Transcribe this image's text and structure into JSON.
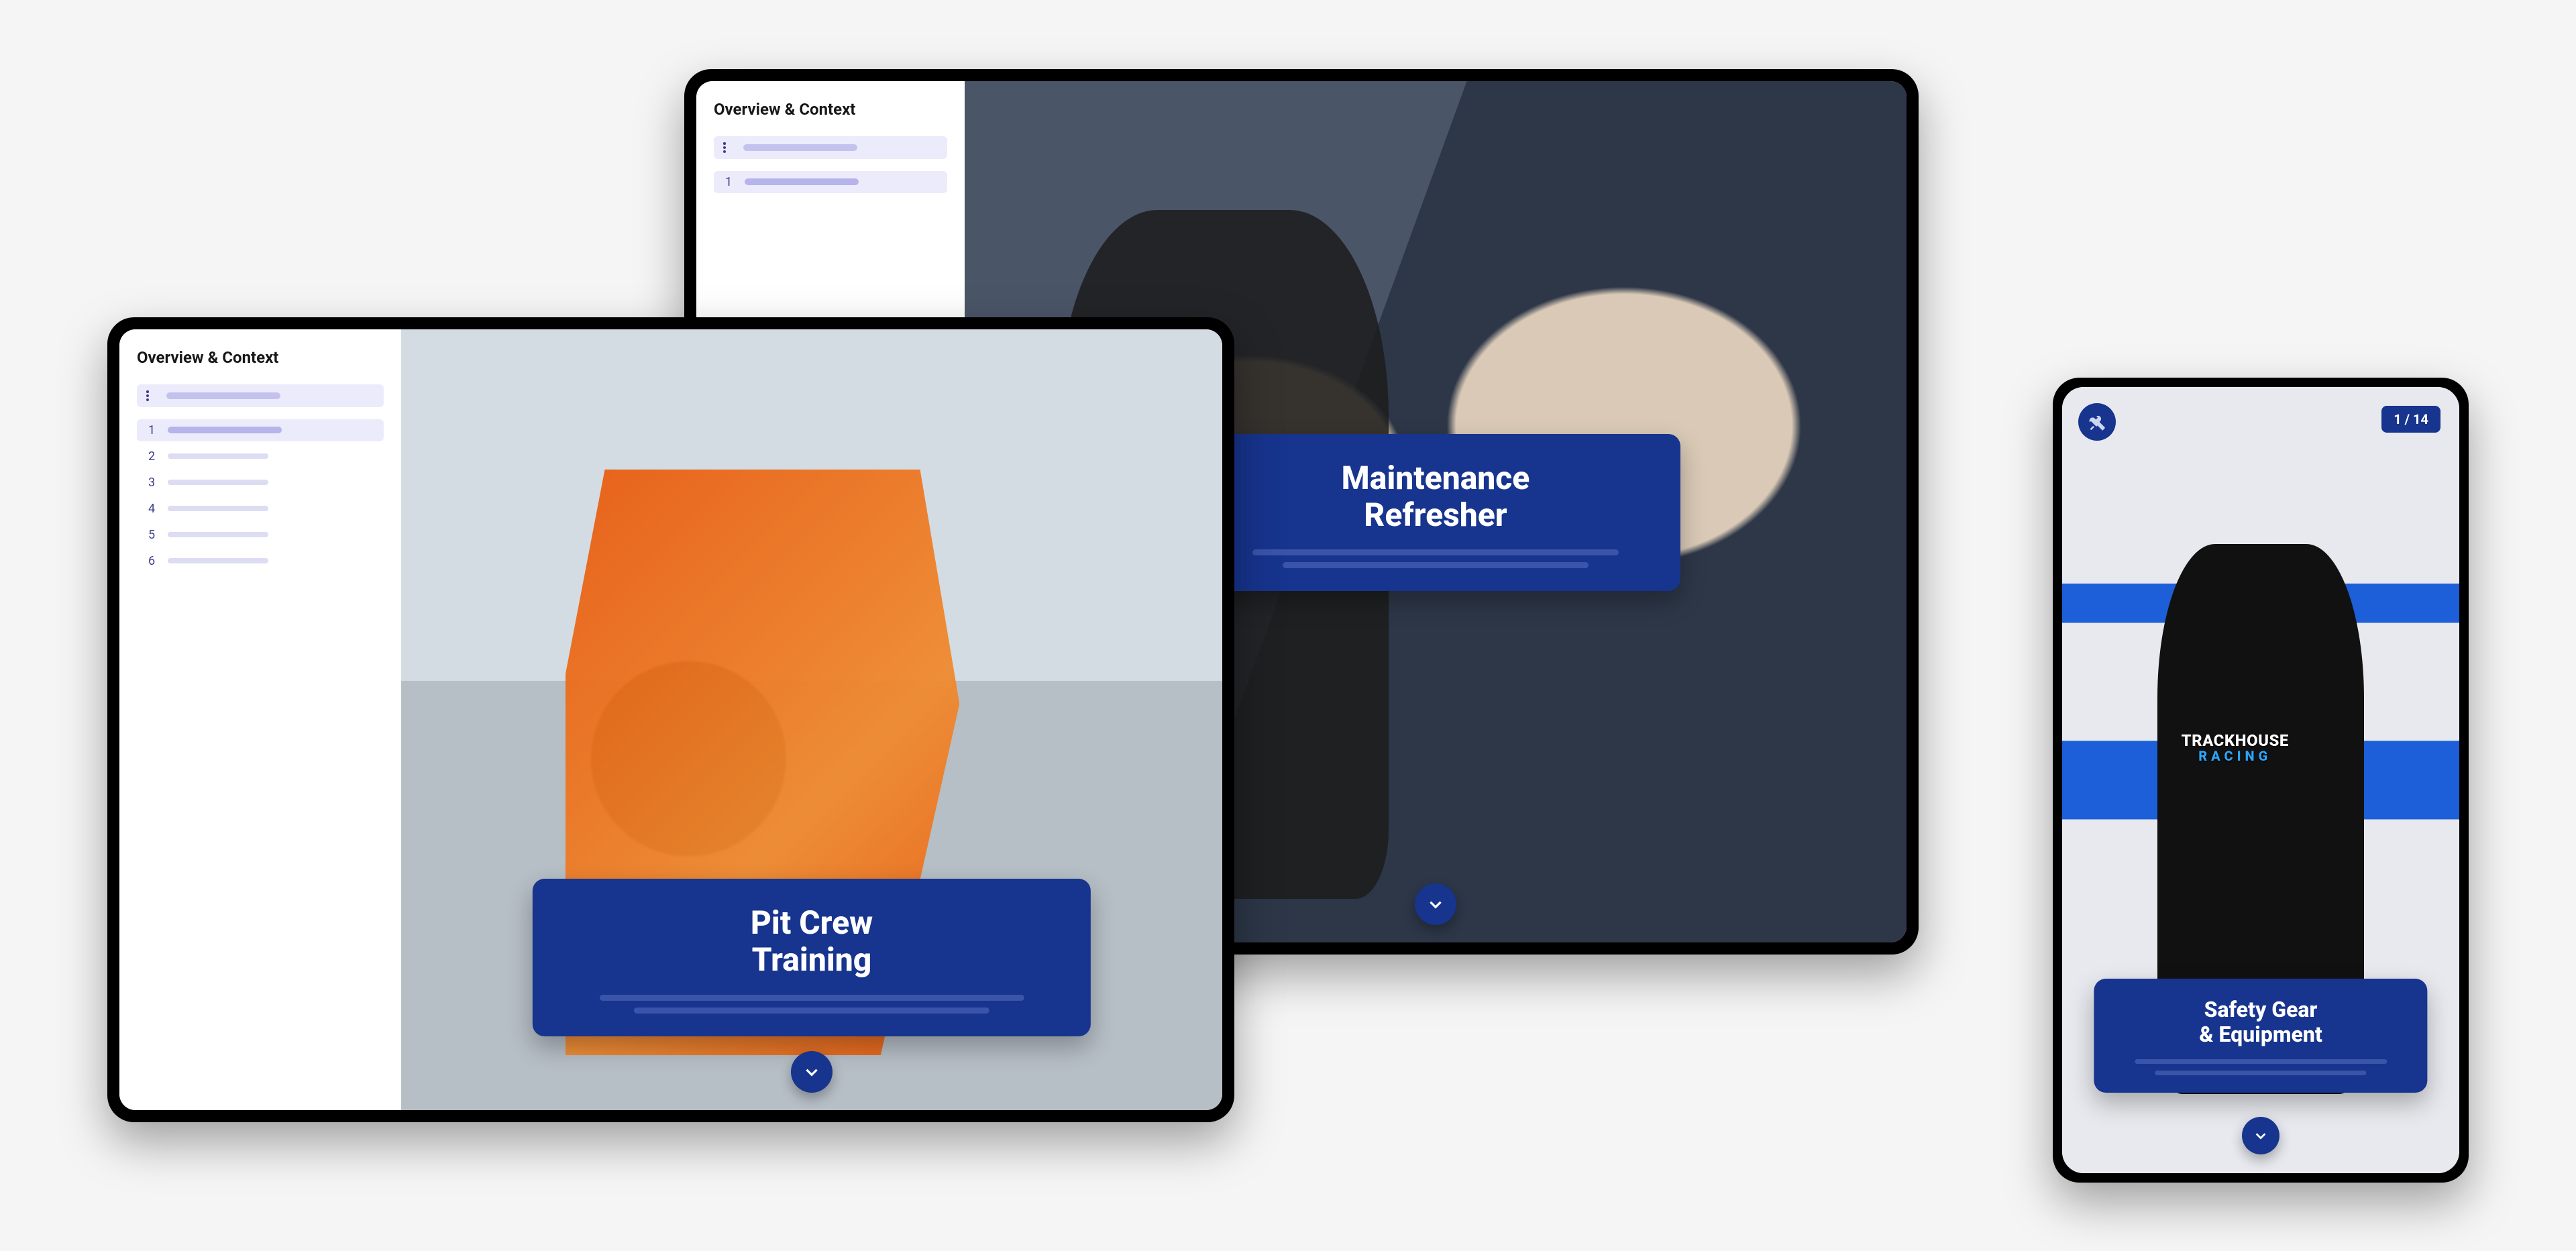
{
  "sidebar": {
    "title": "Overview & Context",
    "items": [
      {
        "num": "1"
      },
      {
        "num": "2"
      },
      {
        "num": "3"
      },
      {
        "num": "4"
      },
      {
        "num": "5"
      },
      {
        "num": "6"
      }
    ]
  },
  "tablet_rear": {
    "title_line1": "Maintenance",
    "title_line2": "Refresher"
  },
  "tablet_front": {
    "title_line1": "Pit Crew",
    "title_line2": "Training"
  },
  "phone": {
    "page_indicator": "1 / 14",
    "title_line1": "Safety Gear",
    "title_line2": "& Equipment",
    "shirt_text_top": "TRACKHOUSE",
    "shirt_text_bottom": "RACING"
  },
  "icons": {
    "tools": "tools-icon",
    "chevron_down": "chevron-down-icon",
    "list": "list-icon"
  },
  "colors": {
    "brand_blue": "#17348e",
    "sidebar_tint": "#ecebfb",
    "skeleton": "#c3c2ee"
  }
}
